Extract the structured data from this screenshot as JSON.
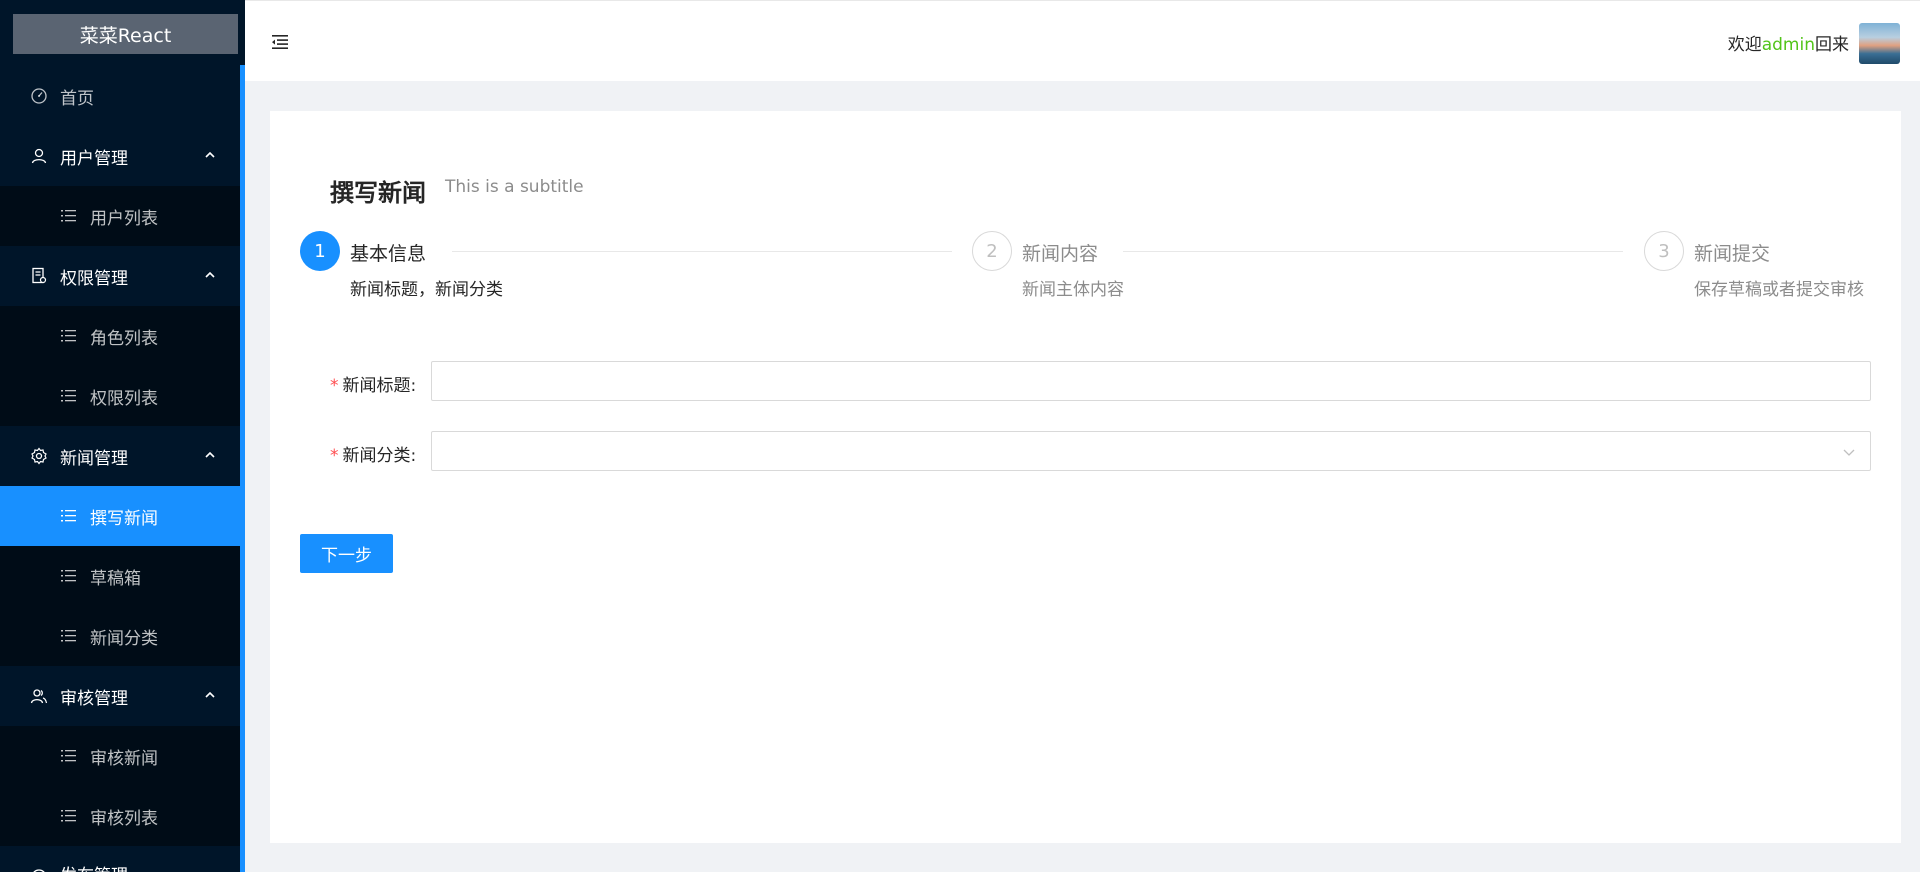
{
  "app": {
    "logo": "菜菜React"
  },
  "sidebar": {
    "items": [
      {
        "label": "首页",
        "icon": "dashboard-icon"
      },
      {
        "label": "用户管理",
        "icon": "user-icon",
        "children": [
          {
            "label": "用户列表"
          }
        ]
      },
      {
        "label": "权限管理",
        "icon": "audit-icon",
        "children": [
          {
            "label": "角色列表"
          },
          {
            "label": "权限列表"
          }
        ]
      },
      {
        "label": "新闻管理",
        "icon": "setting-icon",
        "children": [
          {
            "label": "撰写新闻",
            "active": true
          },
          {
            "label": "草稿箱"
          },
          {
            "label": "新闻分类"
          }
        ]
      },
      {
        "label": "审核管理",
        "icon": "team-icon",
        "children": [
          {
            "label": "审核新闻"
          },
          {
            "label": "审核列表"
          }
        ]
      },
      {
        "label": "发布管理",
        "icon": "publish-icon"
      }
    ]
  },
  "header": {
    "welcome_prefix": "欢迎",
    "username": "admin",
    "welcome_suffix": "回来"
  },
  "page": {
    "title": "撰写新闻",
    "subtitle": "This is a subtitle"
  },
  "steps": [
    {
      "number": "1",
      "title": "基本信息",
      "description": "新闻标题，新闻分类",
      "status": "process"
    },
    {
      "number": "2",
      "title": "新闻内容",
      "description": "新闻主体内容",
      "status": "wait"
    },
    {
      "number": "3",
      "title": "新闻提交",
      "description": "保存草稿或者提交审核",
      "status": "wait"
    }
  ],
  "form": {
    "title_label": "新闻标题:",
    "title_value": "",
    "category_label": "新闻分类:",
    "category_value": "",
    "next_button": "下一步"
  },
  "colors": {
    "primary": "#1890ff",
    "sider_bg": "#001529",
    "username": "#52c41a",
    "required": "#ff4d4f"
  }
}
